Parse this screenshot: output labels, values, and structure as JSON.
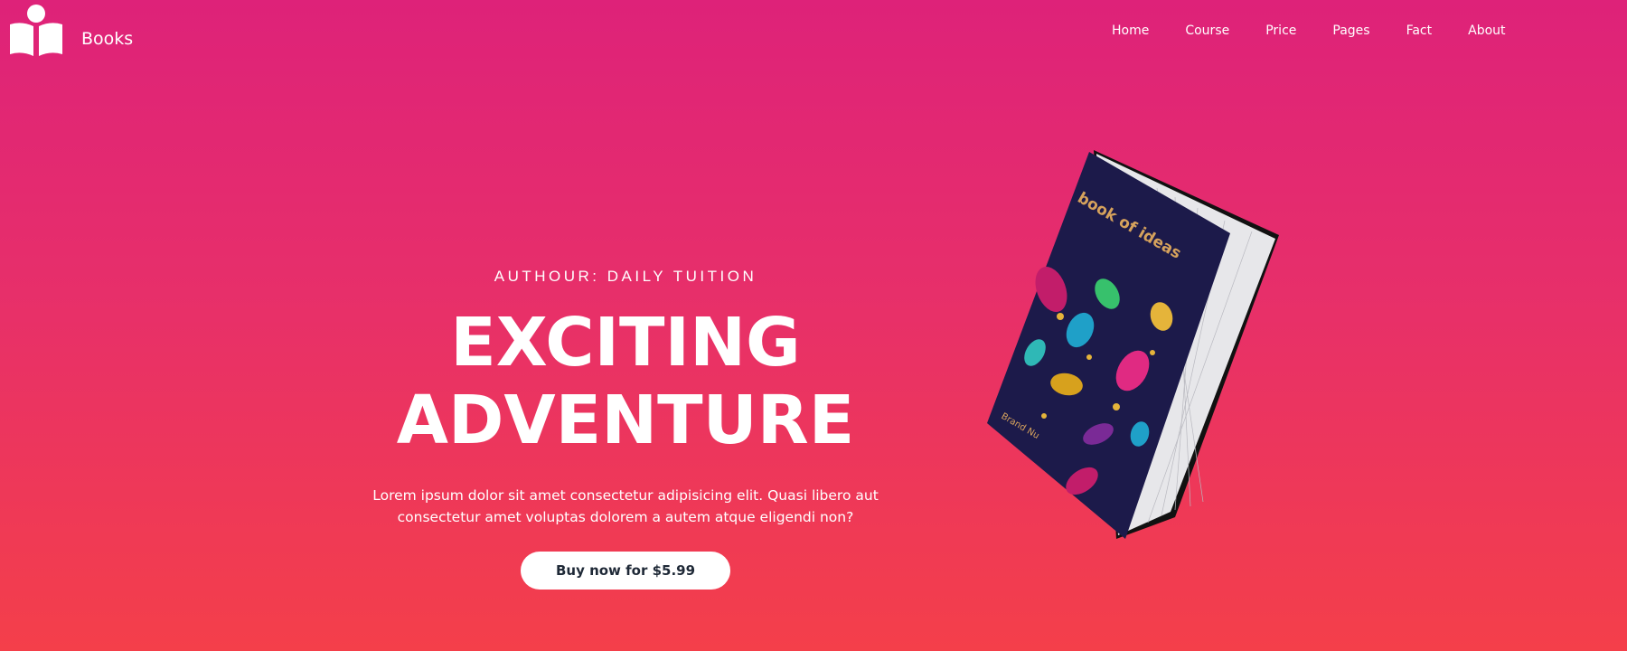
{
  "brand": {
    "name": "Books",
    "icon": "open-book-reader-icon"
  },
  "nav": {
    "items": [
      "Home",
      "Course",
      "Price",
      "Pages",
      "Fact",
      "About"
    ]
  },
  "hero": {
    "kicker": "AUTHOUR: DAILY TUITION",
    "title_line1": "EXCITING",
    "title_line2": "ADVENTURE",
    "description": "Lorem ipsum dolor sit amet consectetur adipisicing elit. Quasi libero aut consectetur amet voluptas dolorem a autem atque eligendi non?",
    "cta_label": "Buy now for $5.99"
  },
  "book": {
    "cover_title": "book of ideas",
    "cover_author": "Brand Nu",
    "cover_color": "#1c1a4a"
  },
  "colors": {
    "gradient_top": "#de2279",
    "gradient_bottom": "#f43f4a",
    "button_bg": "#ffffff",
    "button_text": "#1f2937"
  }
}
